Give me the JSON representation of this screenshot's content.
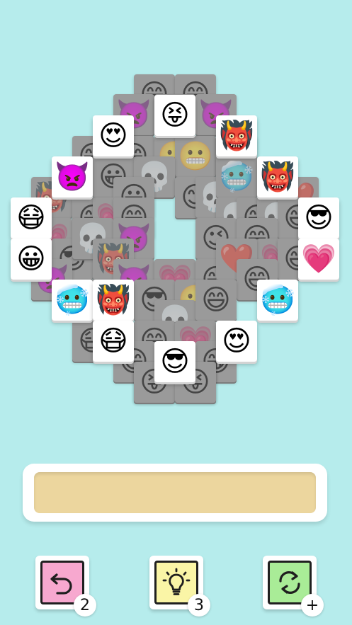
{
  "board": {
    "under_tiles": [
      {
        "icon": "😁"
      },
      {
        "icon": "😁"
      },
      {
        "icon": "👿"
      },
      {
        "icon": "😁"
      },
      {
        "icon": "👿"
      },
      {
        "icon": "😄"
      },
      {
        "icon": "😄"
      },
      {
        "icon": "😬"
      },
      {
        "icon": "😬"
      },
      {
        "icon": "🥶"
      },
      {
        "icon": "😀"
      },
      {
        "icon": "💀"
      },
      {
        "icon": "😀"
      },
      {
        "icon": "😊"
      },
      {
        "icon": "💀"
      },
      {
        "icon": "🥶"
      },
      {
        "icon": "❤️"
      },
      {
        "icon": "👹"
      },
      {
        "icon": "😄"
      },
      {
        "icon": "💗"
      },
      {
        "icon": "😄"
      },
      {
        "icon": "💀"
      },
      {
        "icon": "😄"
      },
      {
        "icon": "💀"
      },
      {
        "icon": "😄"
      },
      {
        "icon": "💗"
      },
      {
        "icon": "😎"
      },
      {
        "icon": "💀"
      },
      {
        "icon": "👿"
      },
      {
        "icon": "😉"
      },
      {
        "icon": "😄"
      },
      {
        "icon": "💗"
      },
      {
        "icon": "😄"
      },
      {
        "icon": "👿"
      },
      {
        "icon": "👹"
      },
      {
        "icon": "👿"
      },
      {
        "icon": "💗"
      },
      {
        "icon": "😄"
      },
      {
        "icon": "❤️"
      },
      {
        "icon": "😄"
      },
      {
        "icon": "😬"
      },
      {
        "icon": "😎"
      },
      {
        "icon": "😬"
      },
      {
        "icon": "💀"
      },
      {
        "icon": "😄"
      },
      {
        "icon": "😷"
      },
      {
        "icon": "😄"
      },
      {
        "icon": "💗"
      },
      {
        "icon": "😁"
      },
      {
        "icon": "😄"
      },
      {
        "icon": "😄"
      },
      {
        "icon": "😄"
      },
      {
        "icon": "😝"
      },
      {
        "icon": "😝"
      }
    ],
    "top_tiles": [
      {
        "icon": "😝",
        "name": "tile-squinting-tongue"
      },
      {
        "icon": "😍",
        "name": "tile-heart-eyes"
      },
      {
        "icon": "👹",
        "name": "tile-ogre"
      },
      {
        "icon": "👿",
        "name": "tile-angry-devil"
      },
      {
        "icon": "👹",
        "name": "tile-ogre"
      },
      {
        "icon": "😷",
        "name": "tile-face-mask"
      },
      {
        "icon": "😎",
        "name": "tile-sunglasses"
      },
      {
        "icon": "😀",
        "name": "tile-grinning"
      },
      {
        "icon": "💗",
        "name": "tile-growing-heart"
      },
      {
        "icon": "🥶",
        "name": "tile-cold-face"
      },
      {
        "icon": "👹",
        "name": "tile-ogre"
      },
      {
        "icon": "🥶",
        "name": "tile-cold-face"
      },
      {
        "icon": "😷",
        "name": "tile-face-mask"
      },
      {
        "icon": "😍",
        "name": "tile-heart-eyes"
      },
      {
        "icon": "😎",
        "name": "tile-sunglasses"
      }
    ]
  },
  "tray": {
    "slots": []
  },
  "powerups": {
    "undo": {
      "icon": "undo-arrow-icon",
      "count": "2",
      "color": "#f7a8cf"
    },
    "hint": {
      "icon": "lightbulb-icon",
      "count": "3",
      "color": "#faf5a6"
    },
    "shuffle": {
      "icon": "shuffle-arrows-icon",
      "count": "+",
      "color": "#a9ec97"
    }
  }
}
